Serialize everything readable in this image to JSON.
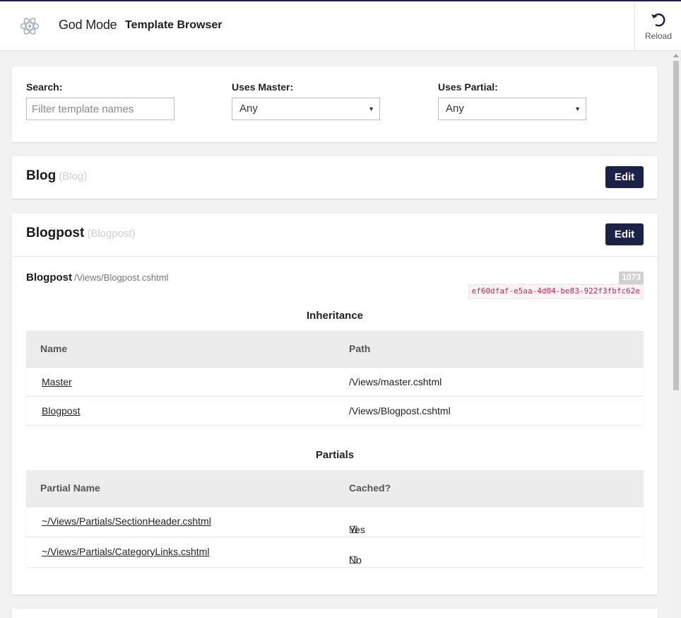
{
  "header": {
    "brand": "God Mode",
    "title": "Template Browser",
    "reload_label": "Reload"
  },
  "filters": {
    "search_label": "Search:",
    "search_placeholder": "Filter template names",
    "master_label": "Uses Master:",
    "master_value": "Any",
    "partial_label": "Uses Partial:",
    "partial_value": "Any"
  },
  "templates": [
    {
      "name": "Blog",
      "alias": "(Blog)",
      "edit_label": "Edit"
    },
    {
      "name": "Blogpost",
      "alias": "(Blogpost)",
      "edit_label": "Edit",
      "detail_name": "Blogpost",
      "detail_path": "/Views/Blogpost.cshtml",
      "id": "1073",
      "guid": "ef60dfaf-e5aa-4d04-be83-922f3fbfc62e",
      "inheritance_title": "Inheritance",
      "inheritance_headers": [
        "Name",
        "Path"
      ],
      "inheritance": [
        {
          "name": "Master",
          "path": "/Views/master.cshtml"
        },
        {
          "name": "Blogpost",
          "path": "/Views/Blogpost.cshtml"
        }
      ],
      "partials_title": "Partials",
      "partials_headers": [
        "Partial Name",
        "Cached?"
      ],
      "partials": [
        {
          "name": "~/Views/Partials/SectionHeader.cshtml",
          "cached": "Yes",
          "checkbox": "☑"
        },
        {
          "name": "~/Views/Partials/CategoryLinks.cshtml",
          "cached": "No",
          "checkbox": "☐"
        }
      ]
    }
  ],
  "colors": {
    "accent": "#1b2147",
    "guid_text": "#c7254e",
    "badge_bg": "#d0d0d0"
  }
}
